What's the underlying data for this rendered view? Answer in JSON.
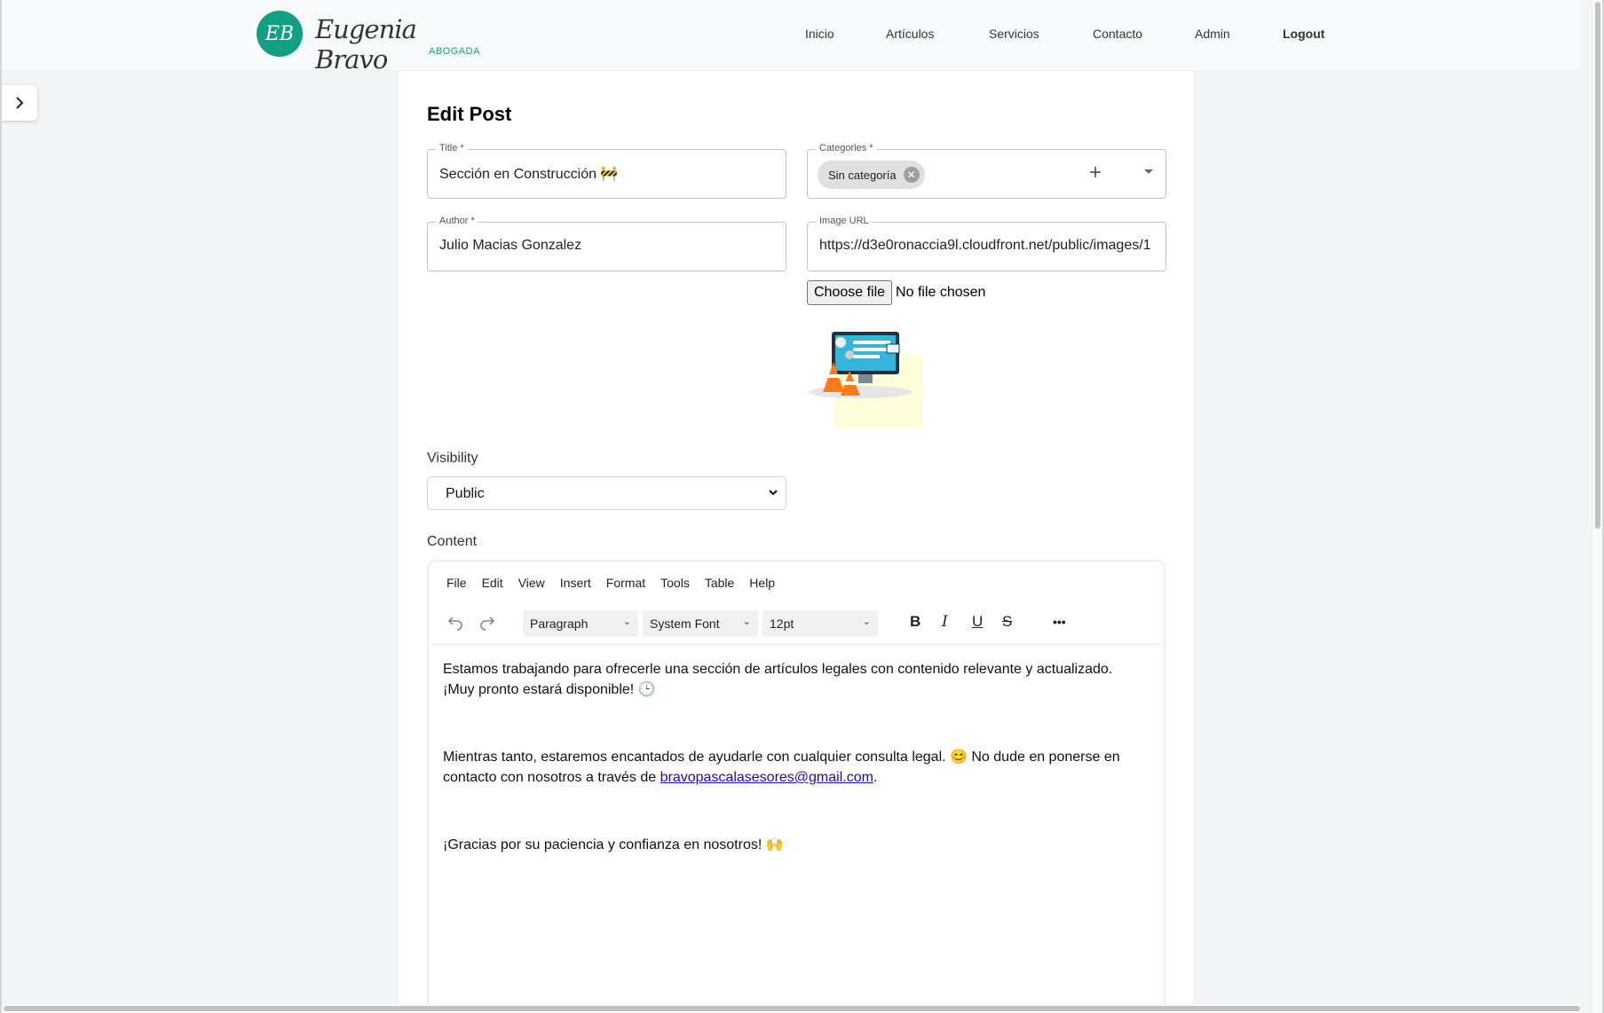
{
  "brand": {
    "monogram": "EB",
    "name": "Eugenia Bravo",
    "subtitle": "ABOGADA",
    "accent_color": "#12a084"
  },
  "nav": {
    "items": [
      "Inicio",
      "Artículos",
      "Servicios",
      "Contacto",
      "Admin"
    ],
    "logout": "Logout"
  },
  "sidebar_toggle_icon": "chevron-right-icon",
  "form": {
    "heading": "Edit Post",
    "title_label": "Title *",
    "title_value": "Sección en Construcción 🚧",
    "categories_label": "Categories *",
    "category_chip": "Sin categoría",
    "chip_remove_icon": "close-circle-icon",
    "add_icon": "plus-icon",
    "author_label": "Author *",
    "author_value": "Julio Macias Gonzalez",
    "image_url_label": "Image URL",
    "image_url_value": "https://d3e0ronaccia9l.cloudfront.net/public/images/1",
    "file_button": "Choose file",
    "file_status": "No file chosen",
    "visibility_label": "Visibility",
    "visibility_value": "Public",
    "content_label": "Content"
  },
  "editor": {
    "menu": [
      "File",
      "Edit",
      "View",
      "Insert",
      "Format",
      "Tools",
      "Table",
      "Help"
    ],
    "block_format": "Paragraph",
    "font_family": "System Font",
    "font_size": "12pt",
    "format_buttons": {
      "bold": "B",
      "italic": "I",
      "underline": "U",
      "strike": "S",
      "more": "•••"
    },
    "paragraph1_line1": "Estamos trabajando para ofrecerle una sección de artículos legales con contenido relevante y actualizado.",
    "paragraph1_line2": "¡Muy pronto estará disponible! 🕒",
    "paragraph2_text": "Mientras tanto, estaremos encantados de ayudarle con cualquier consulta legal. 😊 No dude en ponerse en contacto con nosotros a través de ",
    "paragraph2_email": "bravopascalasesores@gmail.com",
    "paragraph2_end": ".",
    "paragraph3": "¡Gracias por su paciencia y confianza en nosotros! 🙌"
  }
}
